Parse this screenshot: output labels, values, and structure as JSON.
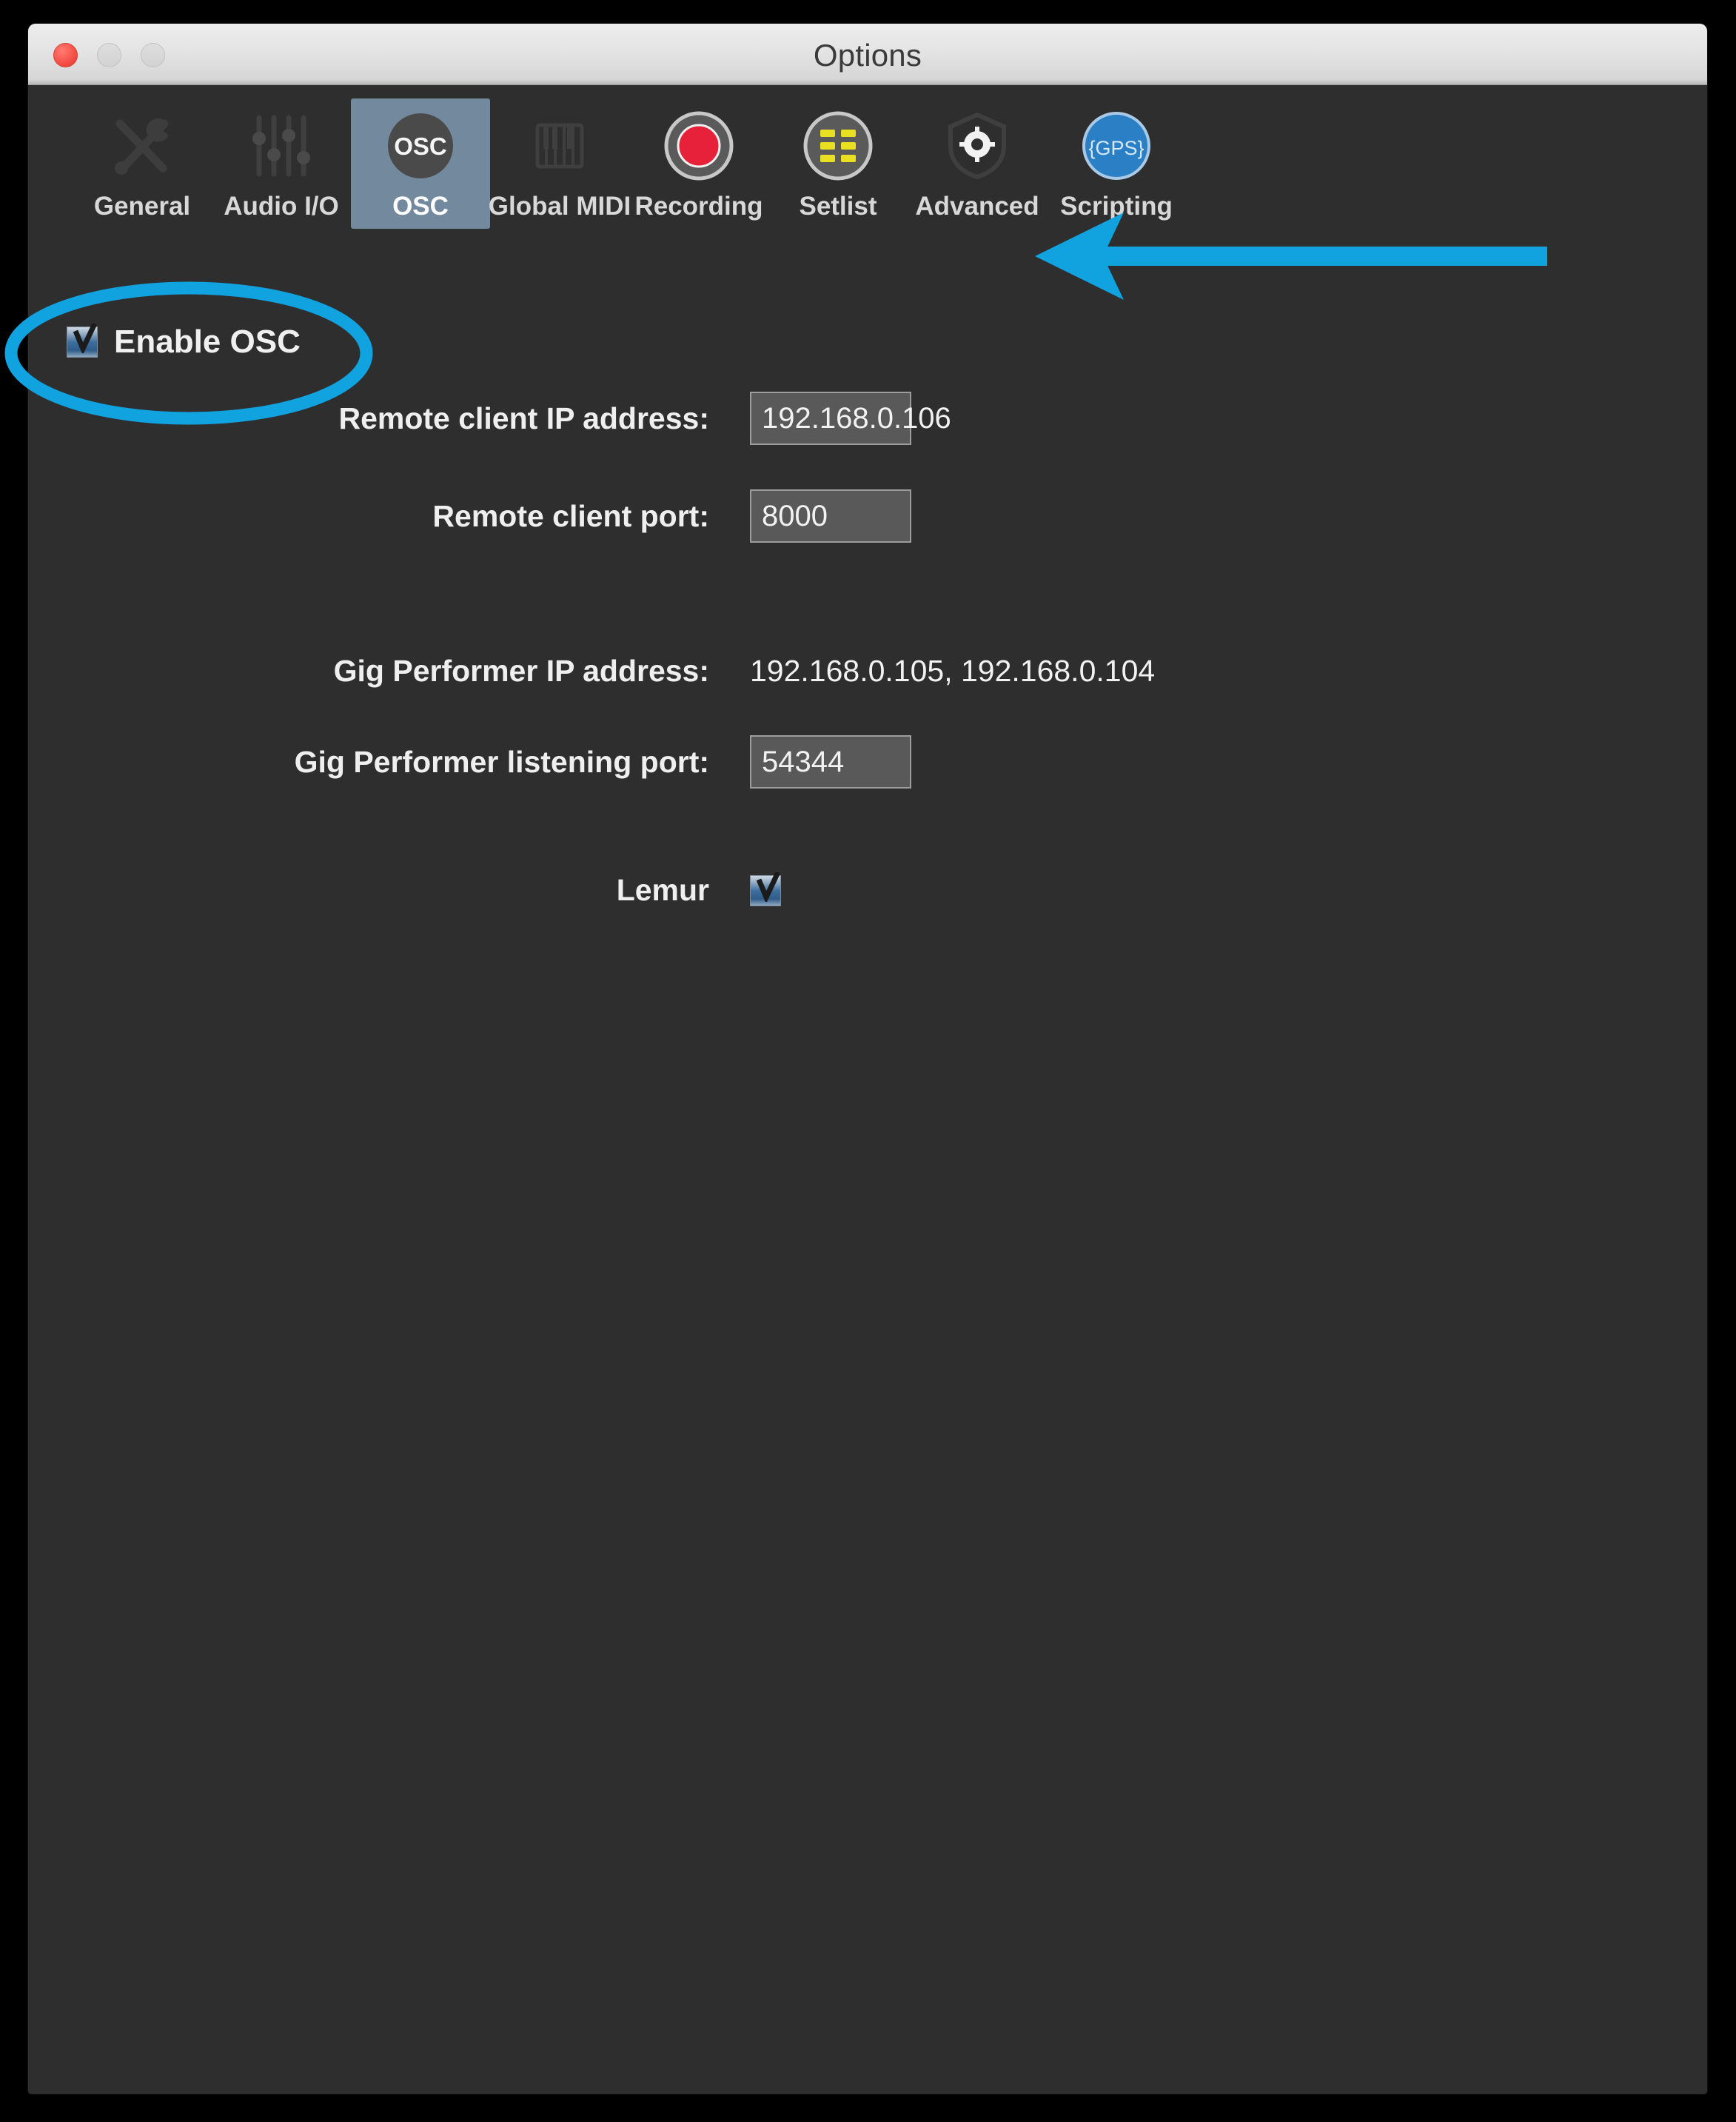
{
  "window": {
    "title": "Options",
    "traffic_lights": [
      "close",
      "minimize",
      "zoom"
    ]
  },
  "toolbar": {
    "items": [
      {
        "label": "General",
        "icon": "wrench-screwdriver-icon",
        "selected": false
      },
      {
        "label": "Audio I/O",
        "icon": "sliders-icon",
        "selected": false
      },
      {
        "label": "OSC",
        "icon": "osc-circle-icon",
        "selected": true
      },
      {
        "label": "Global MIDI",
        "icon": "piano-keys-icon",
        "selected": false
      },
      {
        "label": "Recording",
        "icon": "record-button-icon",
        "selected": false
      },
      {
        "label": "Setlist",
        "icon": "setlist-grid-icon",
        "selected": false
      },
      {
        "label": "Advanced",
        "icon": "shield-gear-icon",
        "selected": false
      },
      {
        "label": "Scripting",
        "icon": "gps-badge-icon",
        "selected": false
      }
    ]
  },
  "content": {
    "enable_osc": {
      "label": "Enable OSC",
      "checked": "true"
    },
    "rows": [
      {
        "label": "Remote client IP address:",
        "value": "192.168.0.106"
      },
      {
        "label": "Remote client port:",
        "value": "8000"
      },
      {
        "label": "Gig Performer IP address:",
        "value": "192.168.0.105, 192.168.0.104"
      },
      {
        "label": "Gig Performer listening port:",
        "value": "54344"
      },
      {
        "label": "Lemur",
        "value": "true"
      }
    ]
  },
  "annotations": {
    "accent_color": "#11a2e0",
    "ellipse_target": "Enable OSC",
    "arrow_target": "Remote client IP address field"
  },
  "colors": {
    "window_background": "#2e2e2e",
    "titlebar": "#e4e4e4",
    "selected_tab": "#72899e",
    "field_background": "#595959",
    "field_border": "#9d9d9d",
    "text": "#f0f0f0",
    "annotation": "#11a2e0",
    "record_red": "#e8213a",
    "setlist_yellow": "#e8e020",
    "scripting_blue": "#2b7fc4"
  }
}
